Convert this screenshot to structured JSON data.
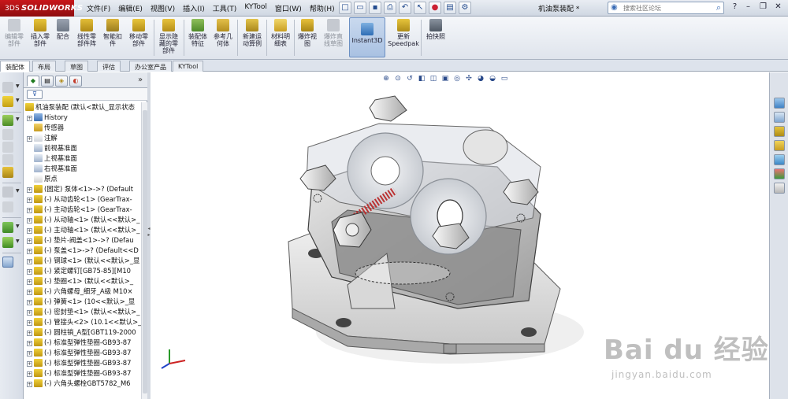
{
  "app": {
    "brand": "SOLIDWORKS",
    "brand_prefix": "3DS",
    "document_title": "机油泵装配 *"
  },
  "menus": [
    "文件(F)",
    "编辑(E)",
    "视图(V)",
    "插入(I)",
    "工具(T)",
    "KYTool",
    "窗口(W)",
    "帮助(H)"
  ],
  "search": {
    "placeholder": "搜索社区论坛"
  },
  "ribbon": {
    "edit_component": "编辑零\n部件",
    "insert_component": "插入零\n部件",
    "mate": "配合",
    "linear_pattern": "线性零\n部件阵",
    "smart_fasteners": "智能扣\n件",
    "move_component": "移动零\n部件",
    "show_hidden": "显示隐\n藏的零\n部件",
    "assembly_features": "装配体\n特征",
    "ref_geometry": "参考几\n何体",
    "new_motion_study": "新建运\n动算例",
    "bom": "材料明\n细表",
    "exploded_view": "爆炸视\n图",
    "explode_line": "爆炸直\n线草图",
    "instant3d": "Instant3D",
    "speedpak": "更新\nSpeedpak",
    "snapshot": "拍快照"
  },
  "command_tabs": [
    "装配体",
    "布局",
    "草图",
    "评估",
    "办公室产品",
    "KYTool"
  ],
  "tree": {
    "root": "机油泵装配 (默认<默认_显示状态",
    "items": [
      {
        "label": "History",
        "icon": "history-icon",
        "expand": true,
        "indent": 1
      },
      {
        "label": "传感器",
        "icon": "sensor-icon",
        "expand": false,
        "indent": 1
      },
      {
        "label": "注解",
        "icon": "annotation-icon",
        "expand": true,
        "indent": 1
      },
      {
        "label": "前视基准面",
        "icon": "plane-icon",
        "expand": false,
        "indent": 1
      },
      {
        "label": "上视基准面",
        "icon": "plane-icon",
        "expand": false,
        "indent": 1
      },
      {
        "label": "右视基准面",
        "icon": "plane-icon",
        "expand": false,
        "indent": 1
      },
      {
        "label": "原点",
        "icon": "origin-icon",
        "expand": false,
        "indent": 1
      },
      {
        "label": "(固定) 泵体<1>->? (Default",
        "icon": "part-icon",
        "expand": true,
        "indent": 1
      },
      {
        "label": "(-) 从动齿轮<1> (GearTrax-",
        "icon": "part-icon",
        "expand": true,
        "indent": 1
      },
      {
        "label": "(-) 主动齿轮<1> (GearTrax-",
        "icon": "part-icon",
        "expand": true,
        "indent": 1
      },
      {
        "label": "(-) 从动轴<1> (默认<<默认>_",
        "icon": "part-icon",
        "expand": true,
        "indent": 1
      },
      {
        "label": "(-) 主动轴<1> (默认<<默认>_",
        "icon": "part-icon",
        "expand": true,
        "indent": 1
      },
      {
        "label": "(-) 垫片-阀盖<1>->? (Defau",
        "icon": "part-icon",
        "expand": true,
        "indent": 1
      },
      {
        "label": "(-) 泵盖<1>->? (Default<<D",
        "icon": "part-icon",
        "expand": true,
        "indent": 1
      },
      {
        "label": "(-) 钢球<1> (默认<<默认>_显",
        "icon": "part-icon",
        "expand": true,
        "indent": 1
      },
      {
        "label": "(-) 紧定螺钉[GB75-85][M10",
        "icon": "part-icon",
        "expand": true,
        "indent": 1
      },
      {
        "label": "(-) 垫圈<1> (默认<<默认>_",
        "icon": "part-icon",
        "expand": true,
        "indent": 1
      },
      {
        "label": "(-) 六角螺母_细牙_A级 M10×",
        "icon": "part-icon",
        "expand": true,
        "indent": 1
      },
      {
        "label": "(-) 弹簧<1> (10<<默认>_显",
        "icon": "part-icon",
        "expand": true,
        "indent": 1
      },
      {
        "label": "(-) 密封垫<1> (默认<<默认>_",
        "icon": "part-icon",
        "expand": true,
        "indent": 1
      },
      {
        "label": "(-) 管接头<2> (10.1<<默认>_",
        "icon": "part-icon",
        "expand": true,
        "indent": 1
      },
      {
        "label": "(-) 圆柱销_A型[GBT119-2000",
        "icon": "part-icon",
        "expand": true,
        "indent": 1
      },
      {
        "label": "(-) 标准型弹性垫圈-GB93-87",
        "icon": "part-icon",
        "expand": true,
        "indent": 1
      },
      {
        "label": "(-) 标准型弹性垫圈-GB93-87",
        "icon": "part-icon",
        "expand": true,
        "indent": 1
      },
      {
        "label": "(-) 标准型弹性垫圈-GB93-87",
        "icon": "part-icon",
        "expand": true,
        "indent": 1
      },
      {
        "label": "(-) 标准型弹性垫圈-GB93-87",
        "icon": "part-icon",
        "expand": true,
        "indent": 1
      },
      {
        "label": "(-) 六角头螺栓GBT5782_M6",
        "icon": "part-icon",
        "expand": true,
        "indent": 1
      }
    ]
  },
  "watermark": {
    "text": "Bai du 经验",
    "url": "jingyan.baidu.com"
  },
  "colors": {
    "brand_red": "#c8171a",
    "part_yellow": "#e6c21f",
    "ribbon_bg": "#e8ecf2"
  }
}
